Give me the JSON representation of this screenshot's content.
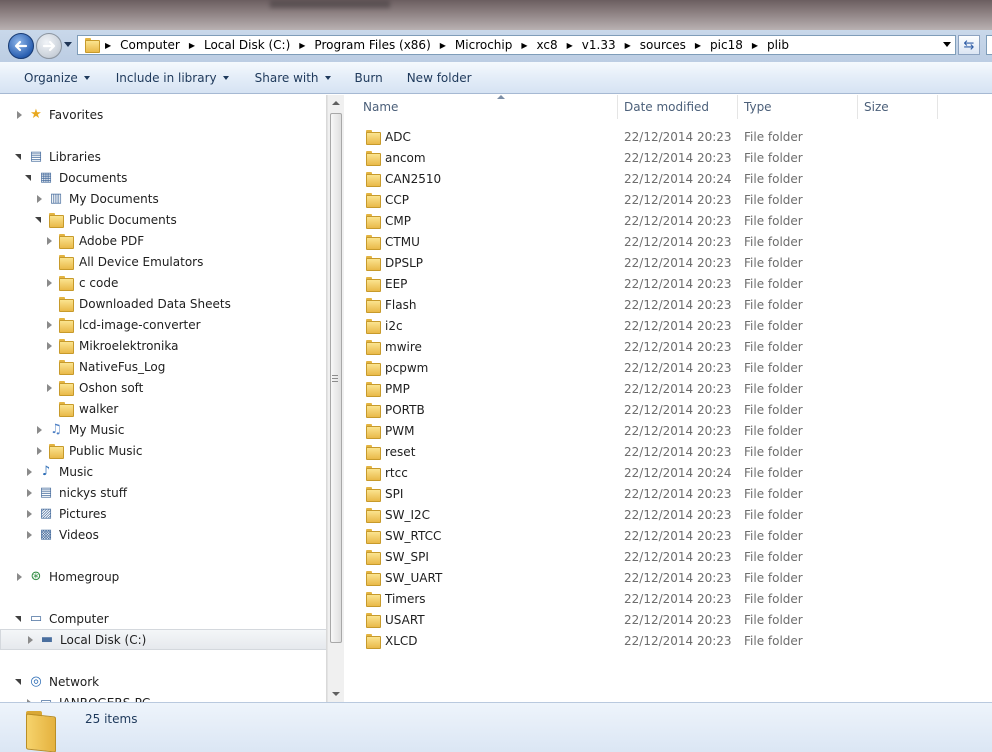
{
  "address_bar": {
    "crumbs": [
      "Computer",
      "Local Disk (C:)",
      "Program Files (x86)",
      "Microchip",
      "xc8",
      "v1.33",
      "sources",
      "pic18",
      "plib"
    ]
  },
  "toolbar": {
    "organize": "Organize",
    "include_in_library": "Include in library",
    "share_with": "Share with",
    "burn": "Burn",
    "new_folder": "New folder"
  },
  "nav_tree": [
    {
      "label": "Favorites",
      "icon": "star-icon",
      "indent": 0,
      "expander": "collapsed"
    },
    {
      "label": "Libraries",
      "icon": "libraries-icon",
      "indent": 0,
      "expander": "expanded"
    },
    {
      "label": "Documents",
      "icon": "documents-icon",
      "indent": 1,
      "expander": "expanded"
    },
    {
      "label": "My Documents",
      "icon": "documents-folder-icon",
      "indent": 2,
      "expander": "collapsed"
    },
    {
      "label": "Public Documents",
      "icon": "folder-icon",
      "indent": 2,
      "expander": "expanded"
    },
    {
      "label": "Adobe PDF",
      "icon": "folder-icon",
      "indent": 3,
      "expander": "collapsed"
    },
    {
      "label": "All Device Emulators",
      "icon": "folder-icon",
      "indent": 3,
      "expander": "none"
    },
    {
      "label": "c code",
      "icon": "folder-icon",
      "indent": 3,
      "expander": "collapsed"
    },
    {
      "label": "Downloaded Data Sheets",
      "icon": "folder-icon",
      "indent": 3,
      "expander": "none"
    },
    {
      "label": "lcd-image-converter",
      "icon": "folder-icon",
      "indent": 3,
      "expander": "collapsed"
    },
    {
      "label": "Mikroelektronika",
      "icon": "folder-icon",
      "indent": 3,
      "expander": "collapsed"
    },
    {
      "label": "NativeFus_Log",
      "icon": "folder-icon",
      "indent": 3,
      "expander": "none"
    },
    {
      "label": "Oshon soft",
      "icon": "folder-icon",
      "indent": 3,
      "expander": "collapsed"
    },
    {
      "label": "walker",
      "icon": "folder-icon",
      "indent": 3,
      "expander": "none"
    },
    {
      "label": "My Music",
      "icon": "music-folder-icon",
      "indent": 2,
      "expander": "collapsed"
    },
    {
      "label": "Public Music",
      "icon": "folder-icon",
      "indent": 2,
      "expander": "collapsed"
    },
    {
      "label": "Music",
      "icon": "music-icon",
      "indent": 1,
      "expander": "collapsed"
    },
    {
      "label": "nickys stuff",
      "icon": "library-icon",
      "indent": 1,
      "expander": "collapsed"
    },
    {
      "label": "Pictures",
      "icon": "pictures-icon",
      "indent": 1,
      "expander": "collapsed"
    },
    {
      "label": "Videos",
      "icon": "videos-icon",
      "indent": 1,
      "expander": "collapsed"
    },
    {
      "label": "",
      "icon": "",
      "indent": 0,
      "expander": "spacer"
    },
    {
      "label": "Homegroup",
      "icon": "homegroup-icon",
      "indent": 0,
      "expander": "collapsed"
    },
    {
      "label": "",
      "icon": "",
      "indent": 0,
      "expander": "spacer"
    },
    {
      "label": "Computer",
      "icon": "computer-icon",
      "indent": 0,
      "expander": "expanded"
    },
    {
      "label": "Local Disk (C:)",
      "icon": "drive-icon",
      "indent": 1,
      "expander": "collapsed",
      "selected": true
    },
    {
      "label": "",
      "icon": "",
      "indent": 0,
      "expander": "spacer"
    },
    {
      "label": "Network",
      "icon": "network-icon",
      "indent": 0,
      "expander": "expanded"
    },
    {
      "label": "IANROGERS-PC",
      "icon": "pc-icon",
      "indent": 1,
      "expander": "collapsed"
    }
  ],
  "columns": {
    "name": "Name",
    "date_modified": "Date modified",
    "type": "Type",
    "size": "Size"
  },
  "files": [
    {
      "name": "ADC",
      "date": "22/12/2014 20:23",
      "type": "File folder"
    },
    {
      "name": "ancom",
      "date": "22/12/2014 20:23",
      "type": "File folder"
    },
    {
      "name": "CAN2510",
      "date": "22/12/2014 20:24",
      "type": "File folder"
    },
    {
      "name": "CCP",
      "date": "22/12/2014 20:23",
      "type": "File folder"
    },
    {
      "name": "CMP",
      "date": "22/12/2014 20:23",
      "type": "File folder"
    },
    {
      "name": "CTMU",
      "date": "22/12/2014 20:23",
      "type": "File folder"
    },
    {
      "name": "DPSLP",
      "date": "22/12/2014 20:23",
      "type": "File folder"
    },
    {
      "name": "EEP",
      "date": "22/12/2014 20:23",
      "type": "File folder"
    },
    {
      "name": "Flash",
      "date": "22/12/2014 20:23",
      "type": "File folder"
    },
    {
      "name": "i2c",
      "date": "22/12/2014 20:23",
      "type": "File folder"
    },
    {
      "name": "mwire",
      "date": "22/12/2014 20:23",
      "type": "File folder"
    },
    {
      "name": "pcpwm",
      "date": "22/12/2014 20:23",
      "type": "File folder"
    },
    {
      "name": "PMP",
      "date": "22/12/2014 20:23",
      "type": "File folder"
    },
    {
      "name": "PORTB",
      "date": "22/12/2014 20:23",
      "type": "File folder"
    },
    {
      "name": "PWM",
      "date": "22/12/2014 20:23",
      "type": "File folder"
    },
    {
      "name": "reset",
      "date": "22/12/2014 20:23",
      "type": "File folder"
    },
    {
      "name": "rtcc",
      "date": "22/12/2014 20:24",
      "type": "File folder"
    },
    {
      "name": "SPI",
      "date": "22/12/2014 20:23",
      "type": "File folder"
    },
    {
      "name": "SW_I2C",
      "date": "22/12/2014 20:23",
      "type": "File folder"
    },
    {
      "name": "SW_RTCC",
      "date": "22/12/2014 20:23",
      "type": "File folder"
    },
    {
      "name": "SW_SPI",
      "date": "22/12/2014 20:23",
      "type": "File folder"
    },
    {
      "name": "SW_UART",
      "date": "22/12/2014 20:23",
      "type": "File folder"
    },
    {
      "name": "Timers",
      "date": "22/12/2014 20:23",
      "type": "File folder"
    },
    {
      "name": "USART",
      "date": "22/12/2014 20:23",
      "type": "File folder"
    },
    {
      "name": "XLCD",
      "date": "22/12/2014 20:23",
      "type": "File folder"
    }
  ],
  "details": {
    "item_count": "25 items"
  },
  "colors": {
    "toolbar_text": "#1e395b",
    "secondary_text": "#6d6d6d",
    "header_text": "#4c607a"
  }
}
